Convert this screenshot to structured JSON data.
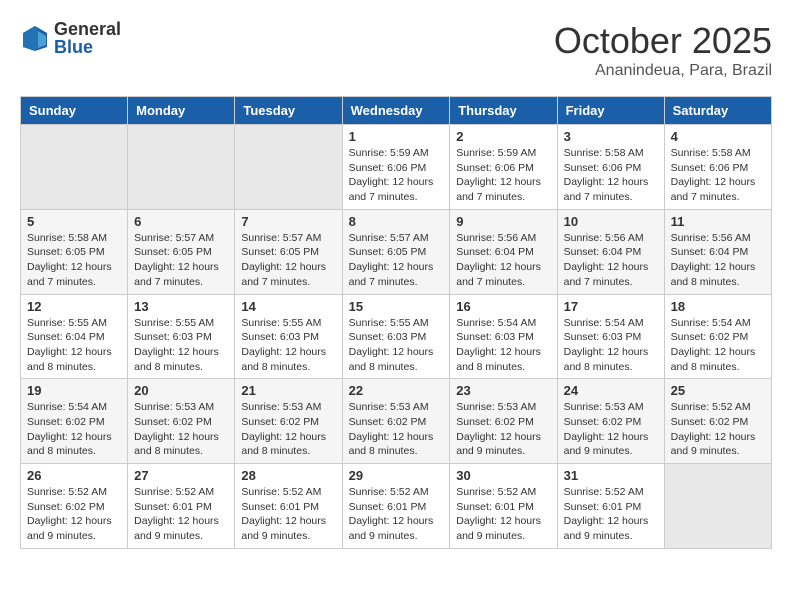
{
  "logo": {
    "general": "General",
    "blue": "Blue"
  },
  "header": {
    "month": "October 2025",
    "location": "Ananindeua, Para, Brazil"
  },
  "days_of_week": [
    "Sunday",
    "Monday",
    "Tuesday",
    "Wednesday",
    "Thursday",
    "Friday",
    "Saturday"
  ],
  "weeks": [
    [
      {
        "day": "",
        "info": ""
      },
      {
        "day": "",
        "info": ""
      },
      {
        "day": "",
        "info": ""
      },
      {
        "day": "1",
        "info": "Sunrise: 5:59 AM\nSunset: 6:06 PM\nDaylight: 12 hours and 7 minutes."
      },
      {
        "day": "2",
        "info": "Sunrise: 5:59 AM\nSunset: 6:06 PM\nDaylight: 12 hours and 7 minutes."
      },
      {
        "day": "3",
        "info": "Sunrise: 5:58 AM\nSunset: 6:06 PM\nDaylight: 12 hours and 7 minutes."
      },
      {
        "day": "4",
        "info": "Sunrise: 5:58 AM\nSunset: 6:06 PM\nDaylight: 12 hours and 7 minutes."
      }
    ],
    [
      {
        "day": "5",
        "info": "Sunrise: 5:58 AM\nSunset: 6:05 PM\nDaylight: 12 hours and 7 minutes."
      },
      {
        "day": "6",
        "info": "Sunrise: 5:57 AM\nSunset: 6:05 PM\nDaylight: 12 hours and 7 minutes."
      },
      {
        "day": "7",
        "info": "Sunrise: 5:57 AM\nSunset: 6:05 PM\nDaylight: 12 hours and 7 minutes."
      },
      {
        "day": "8",
        "info": "Sunrise: 5:57 AM\nSunset: 6:05 PM\nDaylight: 12 hours and 7 minutes."
      },
      {
        "day": "9",
        "info": "Sunrise: 5:56 AM\nSunset: 6:04 PM\nDaylight: 12 hours and 7 minutes."
      },
      {
        "day": "10",
        "info": "Sunrise: 5:56 AM\nSunset: 6:04 PM\nDaylight: 12 hours and 7 minutes."
      },
      {
        "day": "11",
        "info": "Sunrise: 5:56 AM\nSunset: 6:04 PM\nDaylight: 12 hours and 8 minutes."
      }
    ],
    [
      {
        "day": "12",
        "info": "Sunrise: 5:55 AM\nSunset: 6:04 PM\nDaylight: 12 hours and 8 minutes."
      },
      {
        "day": "13",
        "info": "Sunrise: 5:55 AM\nSunset: 6:03 PM\nDaylight: 12 hours and 8 minutes."
      },
      {
        "day": "14",
        "info": "Sunrise: 5:55 AM\nSunset: 6:03 PM\nDaylight: 12 hours and 8 minutes."
      },
      {
        "day": "15",
        "info": "Sunrise: 5:55 AM\nSunset: 6:03 PM\nDaylight: 12 hours and 8 minutes."
      },
      {
        "day": "16",
        "info": "Sunrise: 5:54 AM\nSunset: 6:03 PM\nDaylight: 12 hours and 8 minutes."
      },
      {
        "day": "17",
        "info": "Sunrise: 5:54 AM\nSunset: 6:03 PM\nDaylight: 12 hours and 8 minutes."
      },
      {
        "day": "18",
        "info": "Sunrise: 5:54 AM\nSunset: 6:02 PM\nDaylight: 12 hours and 8 minutes."
      }
    ],
    [
      {
        "day": "19",
        "info": "Sunrise: 5:54 AM\nSunset: 6:02 PM\nDaylight: 12 hours and 8 minutes."
      },
      {
        "day": "20",
        "info": "Sunrise: 5:53 AM\nSunset: 6:02 PM\nDaylight: 12 hours and 8 minutes."
      },
      {
        "day": "21",
        "info": "Sunrise: 5:53 AM\nSunset: 6:02 PM\nDaylight: 12 hours and 8 minutes."
      },
      {
        "day": "22",
        "info": "Sunrise: 5:53 AM\nSunset: 6:02 PM\nDaylight: 12 hours and 8 minutes."
      },
      {
        "day": "23",
        "info": "Sunrise: 5:53 AM\nSunset: 6:02 PM\nDaylight: 12 hours and 9 minutes."
      },
      {
        "day": "24",
        "info": "Sunrise: 5:53 AM\nSunset: 6:02 PM\nDaylight: 12 hours and 9 minutes."
      },
      {
        "day": "25",
        "info": "Sunrise: 5:52 AM\nSunset: 6:02 PM\nDaylight: 12 hours and 9 minutes."
      }
    ],
    [
      {
        "day": "26",
        "info": "Sunrise: 5:52 AM\nSunset: 6:02 PM\nDaylight: 12 hours and 9 minutes."
      },
      {
        "day": "27",
        "info": "Sunrise: 5:52 AM\nSunset: 6:01 PM\nDaylight: 12 hours and 9 minutes."
      },
      {
        "day": "28",
        "info": "Sunrise: 5:52 AM\nSunset: 6:01 PM\nDaylight: 12 hours and 9 minutes."
      },
      {
        "day": "29",
        "info": "Sunrise: 5:52 AM\nSunset: 6:01 PM\nDaylight: 12 hours and 9 minutes."
      },
      {
        "day": "30",
        "info": "Sunrise: 5:52 AM\nSunset: 6:01 PM\nDaylight: 12 hours and 9 minutes."
      },
      {
        "day": "31",
        "info": "Sunrise: 5:52 AM\nSunset: 6:01 PM\nDaylight: 12 hours and 9 minutes."
      },
      {
        "day": "",
        "info": ""
      }
    ]
  ]
}
